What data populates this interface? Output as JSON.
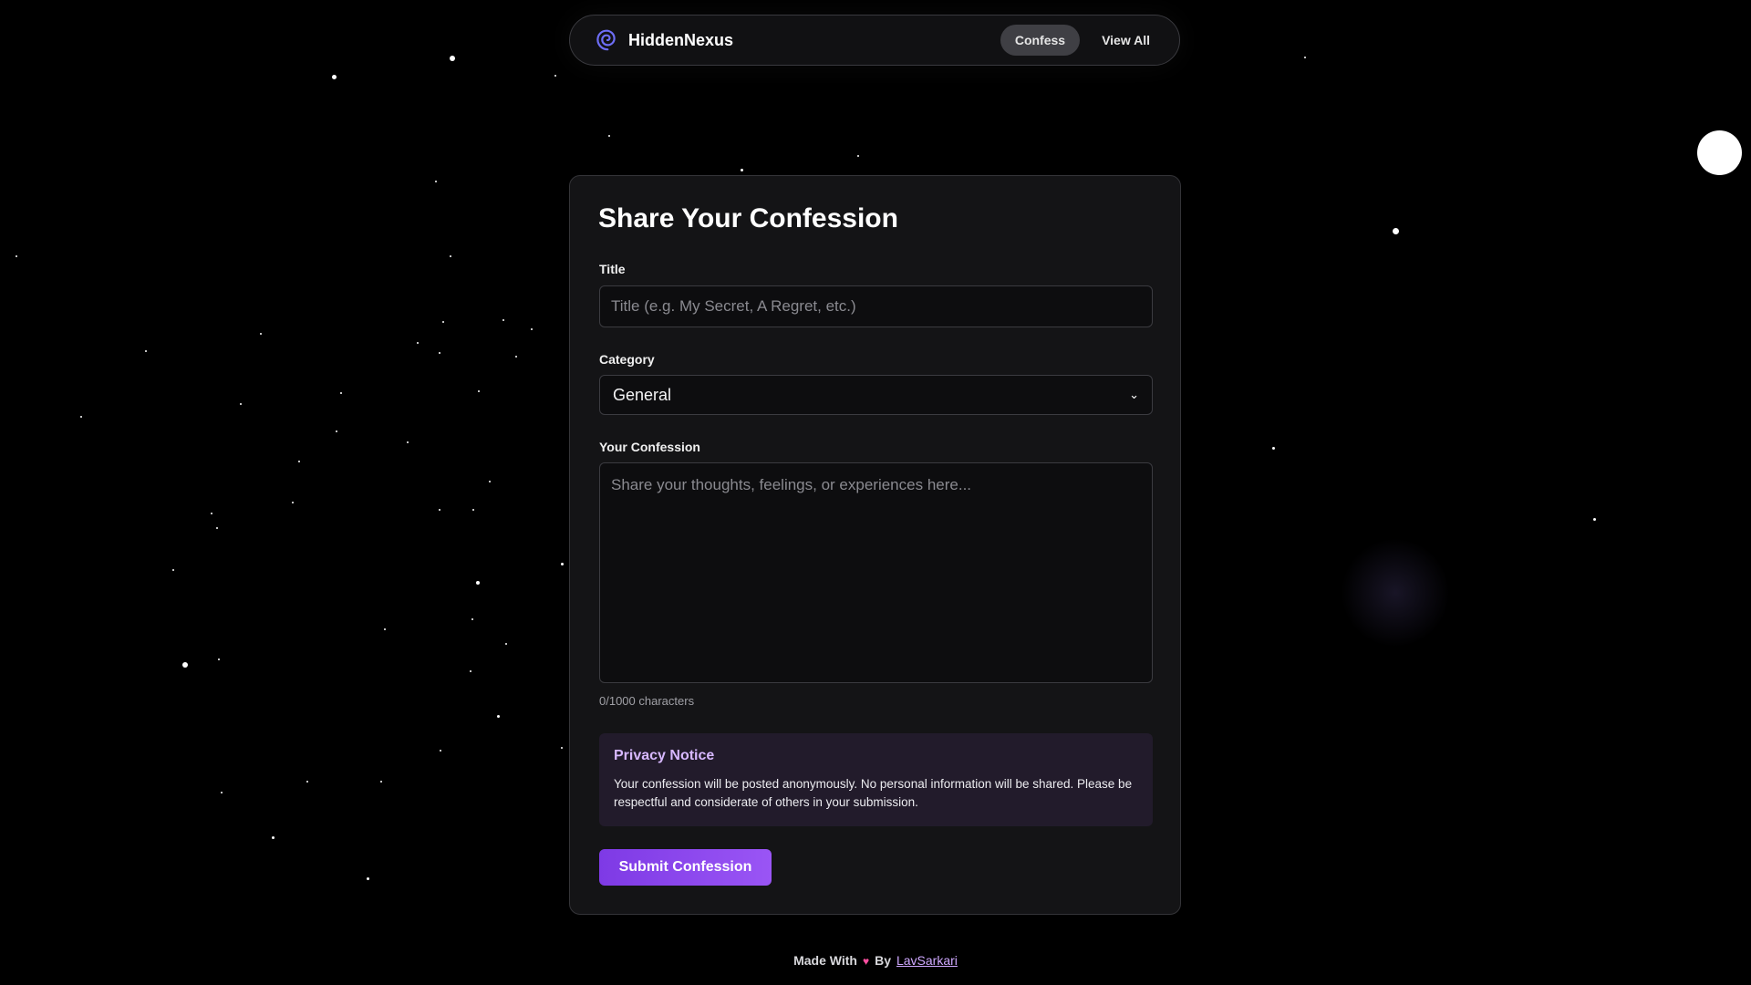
{
  "navbar": {
    "brand": "HiddenNexus",
    "links": [
      {
        "label": "Confess",
        "active": true
      },
      {
        "label": "View All",
        "active": false
      }
    ]
  },
  "form": {
    "heading": "Share Your Confession",
    "title_label": "Title",
    "title_placeholder": "Title (e.g. My Secret, A Regret, etc.)",
    "title_value": "",
    "category_label": "Category",
    "category_selected": "General",
    "confession_label": "Your Confession",
    "confession_placeholder": "Share your thoughts, feelings, or experiences here...",
    "confession_value": "",
    "char_counter": "0/1000 characters",
    "notice_title": "Privacy Notice",
    "notice_text": "Your confession will be posted anonymously. No personal information will be shared. Please be respectful and considerate of others in your submission.",
    "submit_label": "Submit Confession"
  },
  "footer": {
    "made_with": "Made With",
    "by": "By",
    "author": "LavSarkari"
  },
  "colors": {
    "accent": "#8b47f0",
    "notice_title": "#d7b8ff",
    "heart": "#ff4fa0",
    "background": "#000000"
  },
  "icons": {
    "brand": "spiral-icon",
    "heart": "heart-icon",
    "select": "chevron-down-icon"
  }
}
